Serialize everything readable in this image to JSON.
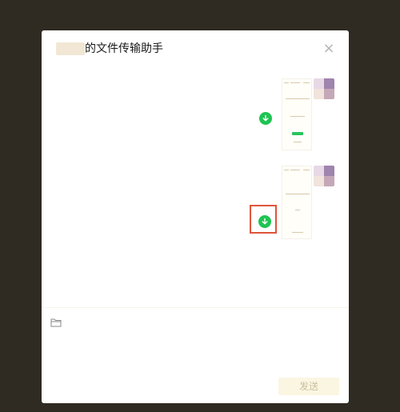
{
  "dialog": {
    "title": "的文件传输助手",
    "close_glyph": "×",
    "send_label": "发送",
    "input_placeholder": ""
  },
  "colors": {
    "backdrop": "#2f2b22",
    "download_green": "#1ec452",
    "highlight_red": "#e0553a",
    "send_bg": "#fbf6e2"
  },
  "icons": {
    "close": "close-icon",
    "download": "download-icon",
    "folder": "folder-icon"
  }
}
